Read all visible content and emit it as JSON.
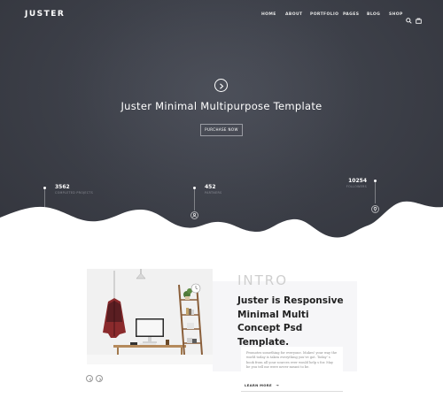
{
  "brand": {
    "logo": "JUSTER"
  },
  "nav": {
    "items": [
      "HOME",
      "ABOUT",
      "PORTFOLIO",
      "PAGES",
      "BLOG",
      "SHOP"
    ],
    "icons": [
      "search-icon",
      "cart-icon"
    ]
  },
  "hero": {
    "title": "Juster Minimal Multipurpose Template",
    "button": "PURCHASE NOW",
    "play_icon": "play-icon"
  },
  "stats": [
    {
      "value": "3562",
      "label": "COMPLETED PROJECTS",
      "icon": "building-icon"
    },
    {
      "value": "452",
      "label": "PARTNERS",
      "icon": "person-icon"
    },
    {
      "value": "10254",
      "label": "FOLLOWERS",
      "icon": "bulb-icon"
    }
  ],
  "intro": {
    "heading_word": "INTRO",
    "title": "Juster is Responsive Minimal Multi Concept Psd Template.",
    "body": "Promotes something for everyone. Makes! your way the world today is taken everything you've got. Today' s book from all your sources ever would help s for. May be you tell me were never meant to be.",
    "link": "LEARN MORE"
  },
  "colors": {
    "hero_bg": "#3d4049",
    "accent": "#ffffff",
    "title": "#222222"
  }
}
